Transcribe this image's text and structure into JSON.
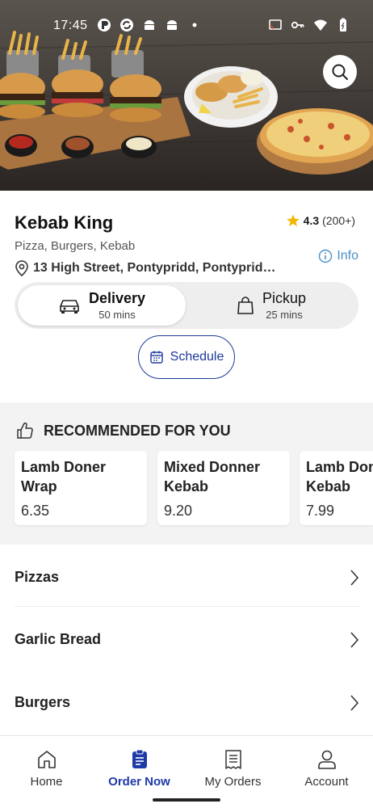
{
  "status_bar": {
    "time": "17:45",
    "left_icons": [
      "status-app-icon",
      "status-sync-icon",
      "android-icon",
      "android-icon",
      "dot-icon"
    ],
    "right_icons": [
      "cast-icon",
      "key-icon",
      "wifi-icon",
      "battery-icon"
    ]
  },
  "hero": {
    "image": "food-hero-image",
    "search_icon": "search-icon"
  },
  "restaurant": {
    "name": "Kebab King",
    "rating": "4.3",
    "rating_count": "(200+)",
    "cuisines": "Pizza, Burgers, Kebab",
    "address": "13 High Street, Pontypridd, Pontyprid…",
    "info_label": "Info"
  },
  "fulfillment": {
    "delivery": {
      "label": "Delivery",
      "time": "50 mins",
      "selected": true
    },
    "pickup": {
      "label": "Pickup",
      "time": "25 mins",
      "selected": false
    },
    "schedule_label": "Schedule"
  },
  "recommended": {
    "title": "RECOMMENDED FOR YOU",
    "items": [
      {
        "name_line1": "Lamb Doner",
        "name_line2": "Wrap",
        "price": "6.35"
      },
      {
        "name_line1": "Mixed Donner",
        "name_line2": "Kebab",
        "price": "9.20"
      },
      {
        "name_line1": "Lamb Doner",
        "name_line2": "Kebab",
        "price": "7.99"
      }
    ]
  },
  "categories": [
    {
      "label": "Pizzas"
    },
    {
      "label": "Garlic Bread"
    },
    {
      "label": "Burgers"
    }
  ],
  "bottom_nav": [
    {
      "label": "Home",
      "icon": "home-icon",
      "active": false
    },
    {
      "label": "Order Now",
      "icon": "order-icon",
      "active": true
    },
    {
      "label": "My Orders",
      "icon": "receipt-icon",
      "active": false
    },
    {
      "label": "Account",
      "icon": "person-icon",
      "active": false
    }
  ],
  "colors": {
    "accent": "#1e3aa8",
    "info_link": "#4a90c6",
    "star": "#f2b705",
    "section_bg": "#f3f3f3"
  }
}
